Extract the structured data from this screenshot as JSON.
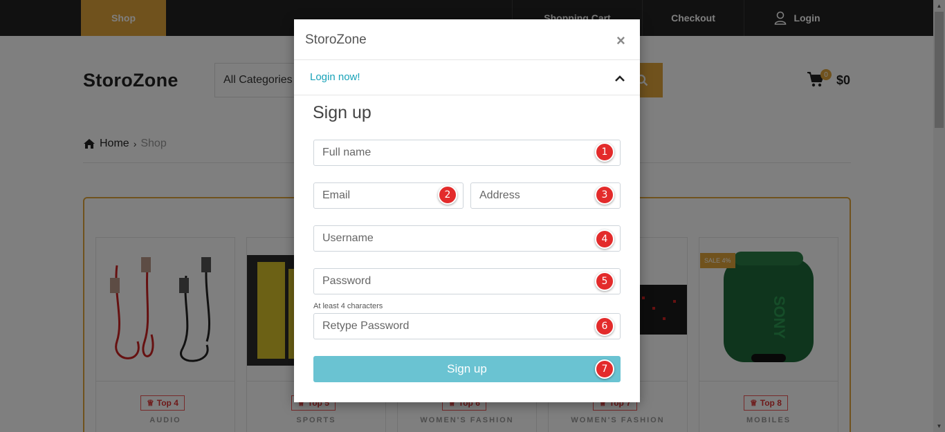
{
  "nav": {
    "shop": "Shop",
    "cart": "Shopping Cart",
    "checkout": "Checkout",
    "login": "Login"
  },
  "header": {
    "brand": "StoroZone",
    "category_select": "All Categories",
    "cart_count": "0",
    "cart_total": "$0"
  },
  "breadcrumb": {
    "home": "Home",
    "current": "Shop"
  },
  "products": [
    {
      "badge": "Top 4",
      "category": "AUDIO"
    },
    {
      "badge": "Top 5",
      "category": "SPORTS"
    },
    {
      "badge": "Top 6",
      "category": "WOMEN'S FASHION"
    },
    {
      "badge": "Top 7",
      "category": "WOMEN'S FASHION"
    },
    {
      "badge": "Top 8",
      "category": "MOBILES",
      "sale": "SALE 4%"
    }
  ],
  "modal": {
    "title": "StoroZone",
    "close": "×",
    "login_link": "Login now!",
    "heading": "Sign up",
    "fields": {
      "full_name": "Full name",
      "email": "Email",
      "address": "Address",
      "username": "Username",
      "password": "Password",
      "password_hint": "At least 4 characters",
      "retype_password": "Retype Password"
    },
    "submit": "Sign up"
  },
  "markers": [
    "1",
    "2",
    "3",
    "4",
    "5",
    "6",
    "7"
  ],
  "colors": {
    "accent": "#e0a53a",
    "button": "#6ac3d2",
    "link": "#17a2b8",
    "marker": "#e32b2b"
  }
}
